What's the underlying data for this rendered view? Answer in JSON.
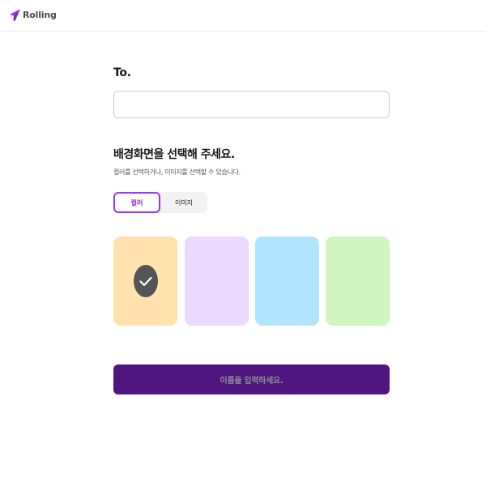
{
  "app": {
    "logo_text": "Rolling"
  },
  "form": {
    "to_label": "To.",
    "to_value": "",
    "to_placeholder": "",
    "background_title": "배경화면을 선택해 주세요.",
    "background_subtitle": "컬러를 선택하거나, 이미지를 선택할 수 있습니다.",
    "tabs": [
      {
        "label": "컬러",
        "active": true
      },
      {
        "label": "이미지",
        "active": false
      }
    ],
    "swatches": [
      {
        "color": "#ffe2ad",
        "selected": true
      },
      {
        "color": "#ecd9ff",
        "selected": false
      },
      {
        "color": "#b1e4ff",
        "selected": false
      },
      {
        "color": "#d0f5c3",
        "selected": false
      }
    ],
    "submit_label": "이름을 입력하세요.",
    "submit_color": "#4e167e",
    "submit_text_color": "#8c8a94"
  },
  "colors": {
    "accent": "#9935ff",
    "logo_mark": "#9935ff"
  }
}
